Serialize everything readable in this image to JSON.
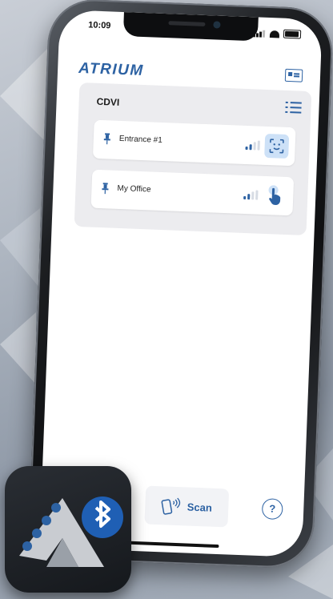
{
  "status_bar": {
    "time": "10:09"
  },
  "header": {
    "logo_text": "ATRIUM",
    "card_icon": "id-card-icon"
  },
  "group": {
    "title": "CDVI",
    "menu_icon": "list-icon",
    "doors": [
      {
        "label": "Entrance #1",
        "icon": "pin-icon",
        "signal_level": 2,
        "action_icon": "face-icon"
      },
      {
        "label": "My Office",
        "icon": "pin-icon",
        "signal_level": 2,
        "action_icon": "tap-hand-icon"
      }
    ]
  },
  "bottom_bar": {
    "scan_label": "Scan",
    "scan_icon": "phone-signal-icon",
    "help_icon": "help-icon"
  },
  "app_icon": {
    "symbol": "bluetooth-icon"
  },
  "colors": {
    "accent": "#2d62a3",
    "signal_active": "#2d62a3",
    "signal_inactive": "#d7dce4",
    "group_bg": "#ececef"
  }
}
